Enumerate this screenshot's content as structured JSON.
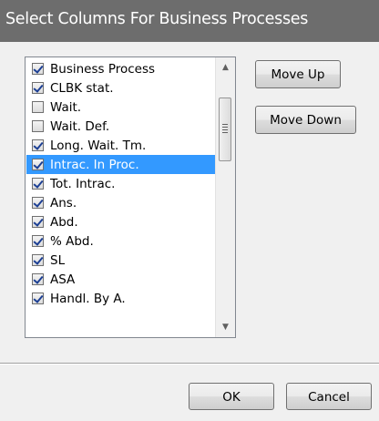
{
  "window": {
    "title": "Select Columns For Business Processes"
  },
  "column_list": {
    "items": [
      {
        "label": "Business Process",
        "checked": true,
        "selected": false
      },
      {
        "label": "CLBK stat.",
        "checked": true,
        "selected": false
      },
      {
        "label": "Wait.",
        "checked": false,
        "selected": false
      },
      {
        "label": "Wait. Def.",
        "checked": false,
        "selected": false
      },
      {
        "label": "Long. Wait. Tm.",
        "checked": true,
        "selected": false
      },
      {
        "label": "Intrac. In Proc.",
        "checked": true,
        "selected": true
      },
      {
        "label": "Tot. Intrac.",
        "checked": true,
        "selected": false
      },
      {
        "label": "Ans.",
        "checked": true,
        "selected": false
      },
      {
        "label": "Abd.",
        "checked": true,
        "selected": false
      },
      {
        "label": "% Abd.",
        "checked": true,
        "selected": false
      },
      {
        "label": "SL",
        "checked": true,
        "selected": false
      },
      {
        "label": "ASA",
        "checked": true,
        "selected": false
      },
      {
        "label": "Handl. By A.",
        "checked": true,
        "selected": false
      }
    ],
    "scroll_up_glyph": "▲",
    "scroll_down_glyph": "▼"
  },
  "buttons": {
    "move_up": "Move Up",
    "move_down": "Move Down",
    "ok": "OK",
    "cancel": "Cancel"
  },
  "colors": {
    "title_bar": "#6d6d6d",
    "selection": "#3399ff",
    "dialog_bg": "#f0f0f0"
  }
}
